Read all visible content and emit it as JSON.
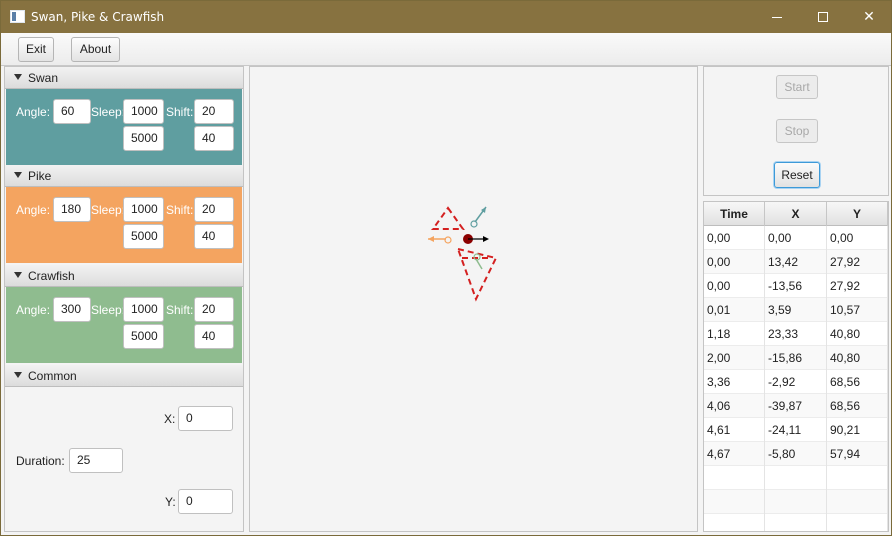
{
  "window": {
    "title": "Swan, Pike & Crawfish",
    "minimize_icon": "minimize-icon",
    "maximize_icon": "maximize-icon",
    "close_icon": "close-icon"
  },
  "menu": {
    "exit_label": "Exit",
    "about_label": "About"
  },
  "sections": {
    "swan": {
      "title": "Swan",
      "color": "#5f9ea0",
      "angle_label": "Angle:",
      "angle": "60",
      "sleep_label": "Sleep:",
      "sleep_min": "1000",
      "sleep_max": "5000",
      "shift_label": "Shift:",
      "shift_min": "20",
      "shift_max": "40"
    },
    "pike": {
      "title": "Pike",
      "color": "#f4a460",
      "angle_label": "Angle:",
      "angle": "180",
      "sleep_label": "Sleep:",
      "sleep_min": "1000",
      "sleep_max": "5000",
      "shift_label": "Shift:",
      "shift_min": "20",
      "shift_max": "40"
    },
    "crawfish": {
      "title": "Crawfish",
      "color": "#8fbc8f",
      "angle_label": "Angle:",
      "angle": "300",
      "sleep_label": "Sleep:",
      "sleep_min": "1000",
      "sleep_max": "5000",
      "shift_label": "Shift:",
      "shift_min": "20",
      "shift_max": "40"
    },
    "common": {
      "title": "Common",
      "x_label": "X:",
      "x": "0",
      "duration_label": "Duration:",
      "duration": "25",
      "y_label": "Y:",
      "y": "0"
    }
  },
  "controls": {
    "start_label": "Start",
    "stop_label": "Stop",
    "reset_label": "Reset"
  },
  "table": {
    "headers": [
      "Time",
      "X",
      "Y"
    ],
    "rows": [
      [
        "0,00",
        "0,00",
        "0,00"
      ],
      [
        "0,00",
        "13,42",
        "27,92"
      ],
      [
        "0,00",
        "-13,56",
        "27,92"
      ],
      [
        "0,01",
        "3,59",
        "10,57"
      ],
      [
        "1,18",
        "23,33",
        "40,80"
      ],
      [
        "2,00",
        "-15,86",
        "40,80"
      ],
      [
        "3,36",
        "-2,92",
        "68,56"
      ],
      [
        "4,06",
        "-39,87",
        "68,56"
      ],
      [
        "4,61",
        "-24,11",
        "90,21"
      ],
      [
        "4,67",
        "-5,80",
        "57,94"
      ]
    ]
  },
  "colors": {
    "titlebar": "#877240",
    "trail": "#d42020",
    "cart": "#8b0000"
  }
}
